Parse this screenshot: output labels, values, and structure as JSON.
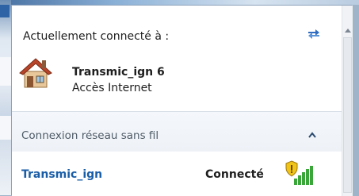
{
  "current": {
    "title": "Actuellement connecté à :",
    "network_name": "Transmic_ign  6",
    "access": "Accès Internet",
    "icon": "house-icon",
    "refresh_icon": "refresh-arrows-icon"
  },
  "wireless": {
    "section_label": "Connexion réseau sans fil",
    "collapse_icon": "chevron-up-icon",
    "networks": [
      {
        "name": "Transmic_ign",
        "status": "Connecté",
        "signal_bars": 5,
        "signal_icon": "wifi-signal-shield-icon"
      }
    ]
  },
  "colors": {
    "link": "#1a5ea8",
    "signal": "#3aa63a",
    "header_bg": "#eef2f7"
  }
}
